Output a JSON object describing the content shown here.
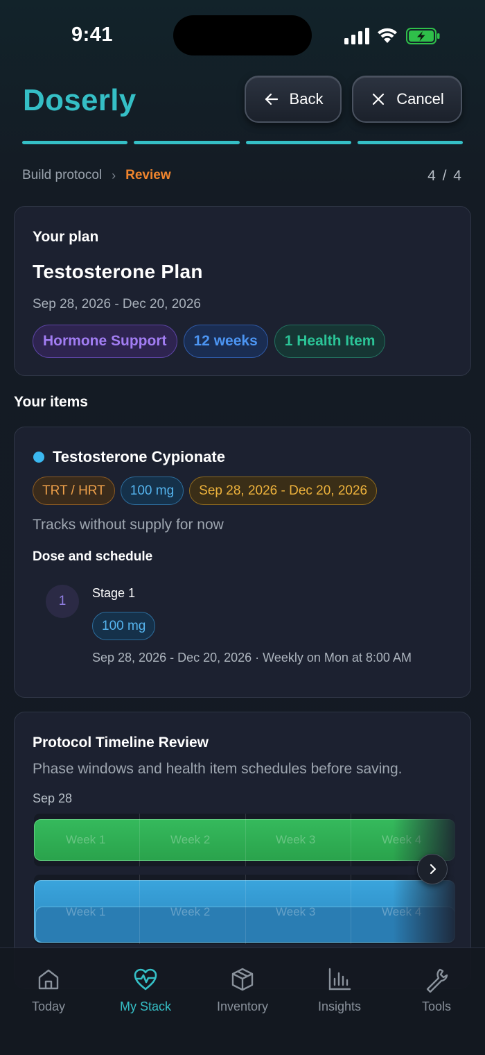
{
  "status_bar": {
    "time": "9:41"
  },
  "header": {
    "app_name": "Doserly",
    "back_label": "Back",
    "cancel_label": "Cancel",
    "progress_steps": 4,
    "progress_completed": 4
  },
  "breadcrumb": {
    "parent": "Build protocol",
    "current": "Review",
    "step_count": "4 / 4"
  },
  "plan": {
    "kicker": "Your plan",
    "title": "Testosterone Plan",
    "dates": "Sep 28, 2026 - Dec 20, 2026",
    "chips": [
      "Hormone Support",
      "12 weeks",
      "1 Health Item"
    ]
  },
  "items_section": {
    "title": "Your items",
    "items": [
      {
        "name": "Testosterone Cypionate",
        "dot_color": "#3bb8f0",
        "tags": [
          "TRT / HRT",
          "100 mg",
          "Sep 28, 2026 - Dec 20, 2026"
        ],
        "note": "Tracks without supply for now",
        "schedule_title": "Dose and schedule",
        "stages": [
          {
            "number": "1",
            "label": "Stage 1",
            "dose": "100 mg",
            "detail": "Sep 28, 2026 - Dec 20, 2026 · Weekly on Mon at 8:00 AM"
          }
        ]
      }
    ]
  },
  "timeline": {
    "title": "Protocol Timeline Review",
    "subtitle": "Phase windows and health item schedules before saving.",
    "start_label": "Sep 28",
    "weeks": [
      "Week 1",
      "Week 2",
      "Week 3",
      "Week 4"
    ],
    "colors": {
      "phase": "#2faa52",
      "item": "#2f90c8"
    }
  },
  "tab_bar": {
    "tabs": [
      {
        "label": "Today",
        "icon": "home-icon",
        "active": false
      },
      {
        "label": "My Stack",
        "icon": "heart-pulse-icon",
        "active": true
      },
      {
        "label": "Inventory",
        "icon": "box-icon",
        "active": false
      },
      {
        "label": "Insights",
        "icon": "bar-chart-icon",
        "active": false
      },
      {
        "label": "Tools",
        "icon": "wrench-icon",
        "active": false
      }
    ]
  },
  "theme": {
    "accent": "#35bfc6",
    "breadcrumb_current": "#f0852d",
    "background": "#141a23"
  }
}
